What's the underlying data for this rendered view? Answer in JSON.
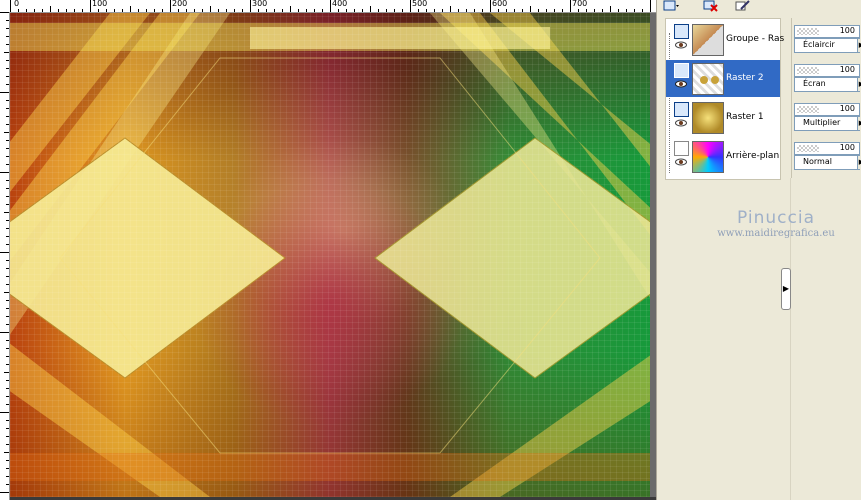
{
  "ruler": {
    "top_labels": [
      "100",
      "200",
      "300",
      "400",
      "500",
      "600",
      "700"
    ],
    "left_labels": [
      "100",
      "200",
      "300",
      "400",
      "500"
    ]
  },
  "layers": [
    {
      "name": "Groupe - Ras",
      "thumb": "group-thumb",
      "selected": false,
      "opacity": "100",
      "mode": "Éclaircir"
    },
    {
      "name": "Raster 2",
      "thumb": "raster2-thumb",
      "selected": true,
      "opacity": "100",
      "mode": "Écran"
    },
    {
      "name": "Raster 1",
      "thumb": "raster1-thumb",
      "selected": false,
      "opacity": "100",
      "mode": "Multiplier"
    },
    {
      "name": "Arrière-plan",
      "thumb": "background-thumb",
      "selected": false,
      "opacity": "100",
      "mode": "Normal"
    }
  ],
  "watermark": {
    "title": "Pinuccia",
    "url": "www.maidiregrafica.eu"
  },
  "colors": {
    "selection": "#316ac5",
    "panel": "#ece9d8"
  }
}
